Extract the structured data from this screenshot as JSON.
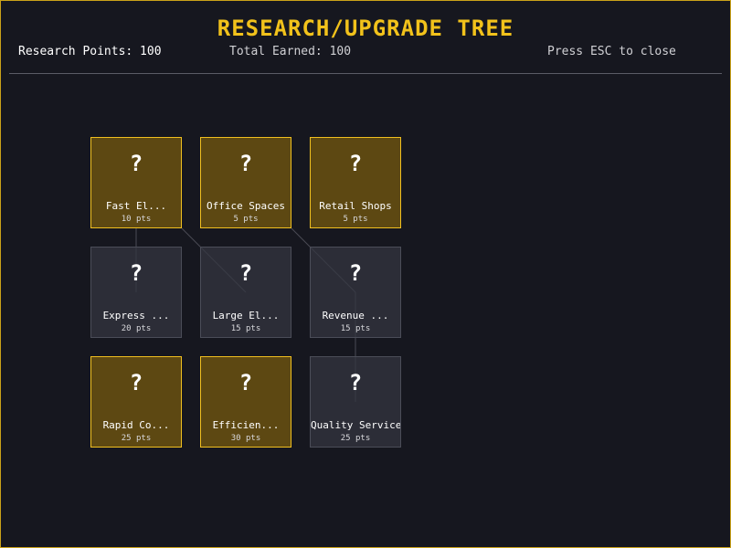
{
  "header": {
    "title": "RESEARCH/UPGRADE TREE",
    "research_points": "Research Points: 100",
    "total_earned": "Total Earned: 100",
    "close_hint": "Press ESC to close"
  },
  "colors": {
    "accent": "#f2c21b",
    "available_bg": "#785c0e",
    "available_border": "#f0bf1f",
    "locked_bg": "#343640",
    "locked_border": "#4b4d58",
    "background": "#16171f"
  },
  "nodes": [
    {
      "icon": "?",
      "icon_name": "question-mark-icon",
      "name": "Fast El...",
      "cost": "10 pts",
      "state": "available"
    },
    {
      "icon": "?",
      "icon_name": "question-mark-icon",
      "name": "Office Spaces",
      "cost": "5 pts",
      "state": "available"
    },
    {
      "icon": "?",
      "icon_name": "question-mark-icon",
      "name": "Retail Shops",
      "cost": "5 pts",
      "state": "available"
    },
    {
      "icon": "?",
      "icon_name": "question-mark-icon",
      "name": "Express ...",
      "cost": "20 pts",
      "state": "locked"
    },
    {
      "icon": "?",
      "icon_name": "question-mark-icon",
      "name": "Large El...",
      "cost": "15 pts",
      "state": "locked"
    },
    {
      "icon": "?",
      "icon_name": "question-mark-icon",
      "name": "Revenue ...",
      "cost": "15 pts",
      "state": "locked"
    },
    {
      "icon": "?",
      "icon_name": "question-mark-icon",
      "name": "Rapid Co...",
      "cost": "25 pts",
      "state": "available"
    },
    {
      "icon": "?",
      "icon_name": "question-mark-icon",
      "name": "Efficien...",
      "cost": "30 pts",
      "state": "available"
    },
    {
      "icon": "?",
      "icon_name": "question-mark-icon",
      "name": "Quality Service",
      "cost": "25 pts",
      "state": "locked"
    }
  ]
}
